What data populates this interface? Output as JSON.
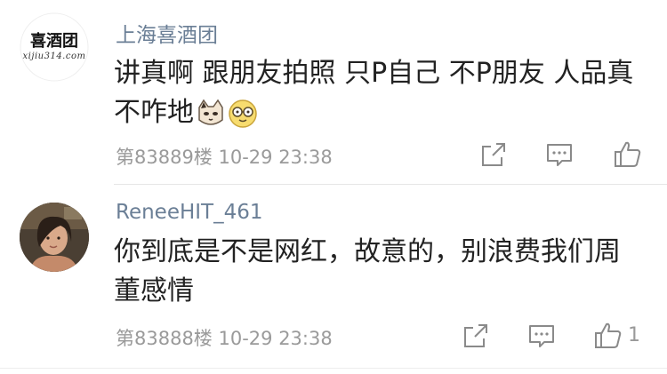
{
  "comments": [
    {
      "username": "上海喜酒团",
      "avatar_text": "xijiu314.com",
      "text": "讲真啊 跟朋友拍照 只P自己 不P朋友 人品真不咋地",
      "emojis": [
        "cat-face-emoji",
        "glasses-face-emoji"
      ],
      "floor": "第83889楼",
      "datetime": "10-29 23:38",
      "likes": ""
    },
    {
      "username": "ReneeHIT_461",
      "text": "你到底是不是网红，故意的，别浪费我们周董感情",
      "floor": "第83888楼",
      "datetime": "10-29 23:38",
      "likes": "1"
    }
  ],
  "actions": {
    "share_icon": "share-icon",
    "reply_icon": "comment-icon",
    "like_icon": "thumbs-up-icon"
  },
  "colors": {
    "username": "#6b7f96",
    "text": "#222222",
    "meta": "#9a9a9a",
    "icon": "#8a8a8a"
  }
}
